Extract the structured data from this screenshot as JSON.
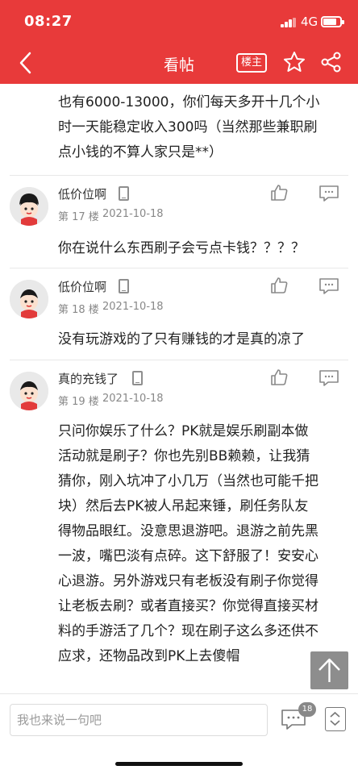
{
  "status_bar": {
    "time": "08:27",
    "network": "4G"
  },
  "nav": {
    "title": "看帖",
    "louzhu_label": "楼主",
    "icons": [
      "back-arrow-icon",
      "star-icon",
      "share-icon"
    ]
  },
  "post_continuation": {
    "lines": [
      "也有6000-13000，你们每天多开十几个小",
      "时一天能稳定收入300吗（当然那些兼职刷",
      "点小钱的不算人家只是**）"
    ]
  },
  "posts": [
    {
      "username": "低价位啊",
      "floor": "第 17 楼",
      "date": "2021-10-18",
      "lines": [
        "你在说什么东西刷子会亏点卡钱？？？？"
      ]
    },
    {
      "username": "低价位啊",
      "floor": "第 18 楼",
      "date": "2021-10-18",
      "lines": [
        "没有玩游戏的了只有赚钱的才是真的凉了"
      ]
    },
    {
      "username": "真的充钱了",
      "floor": "第 19 楼",
      "date": "2021-10-18",
      "lines": [
        "只问你娱乐了什么？PK就是娱乐刷副本做",
        "活动就是刷子？你也先别BB赖赖，让我猜",
        "猜你，刚入坑冲了小几万（当然也可能千把",
        "块）然后去PK被人吊起来锤，刷任务队友",
        "得物品眼红。没意思退游吧。退游之前先黑",
        "一波，嘴巴淡有点碎。这下舒服了！安安心",
        "心退游。另外游戏只有老板没有刷子你觉得",
        "让老板去刷？或者直接买？你觉得直接买材",
        "料的手游活了几个？现在刷子这么多还供不",
        "应求，还物品改到PK上去傻帽"
      ]
    }
  ],
  "bottom_bar": {
    "input_placeholder": "我也来说一句吧",
    "comment_count": "18"
  },
  "colors": {
    "accent": "#e83a3a",
    "text": "#222222",
    "meta": "#888888"
  }
}
